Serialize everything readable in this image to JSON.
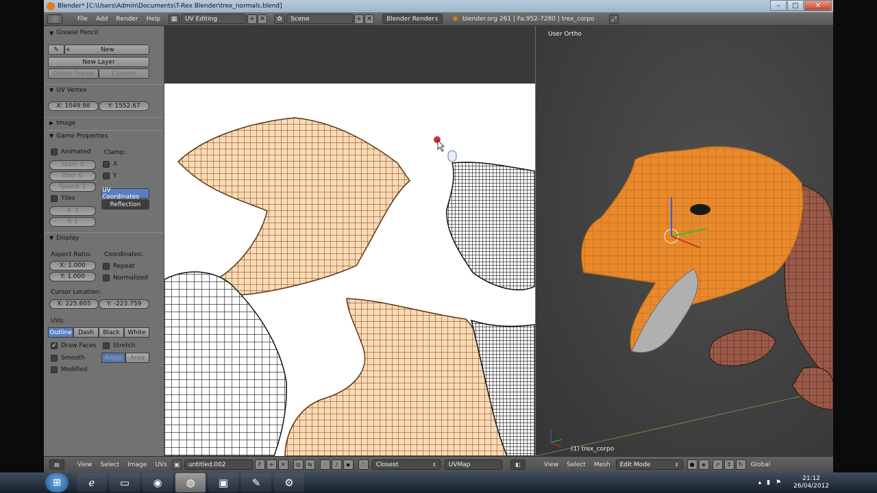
{
  "window": {
    "title": "Blender* [C:\\Users\\Admin\\Documents\\T-Rex Blender\\trex_normals.blend]",
    "min": "–",
    "max": "□",
    "close": "✕"
  },
  "topbar": {
    "menus": [
      "File",
      "Add",
      "Render",
      "Help"
    ],
    "screen_layout": "UV Editing",
    "scene": "Scene",
    "render_engine": "Blender Render",
    "info": "blender.org 261 | Fa:952-7280 | trex_corpo"
  },
  "grease_pencil": {
    "header": "Grease Pencil",
    "new": "New",
    "new_layer": "New Layer",
    "delete_frame": "Delete Frame",
    "convert": "Convert"
  },
  "uv_vertex": {
    "header": "UV Vertex",
    "x": "X: 1049.98",
    "y": "Y: 1552.67"
  },
  "image": {
    "header": "Image"
  },
  "game_properties": {
    "header": "Game Properties",
    "animated": "Animated",
    "clamp": "Clamp:",
    "start": "Start: 0",
    "end": "End: 0",
    "speed": "Speed: 1",
    "clamp_x": "X",
    "clamp_y": "Y",
    "uv_coordinates": "UV Coordinates",
    "reflection": "Reflection",
    "tiles": "Tiles",
    "tiles_x": "X: 1",
    "tiles_y": "Y: 1"
  },
  "display": {
    "header": "Display",
    "aspect_ratio": "Aspect Ratio:",
    "coordinates": "Coordinates:",
    "aspect_x": "X: 1.000",
    "aspect_y": "Y: 1.000",
    "repeat": "Repeat",
    "normalized": "Normalized",
    "cursor_location": "Cursor Location:",
    "cursor_x": "X: 225.605",
    "cursor_y": "Y: -223.759",
    "uvs": "UVs:",
    "uv_modes": [
      "Outline",
      "Dash",
      "Black",
      "White"
    ],
    "draw_faces": "Draw Faces",
    "stretch": "Stretch",
    "smooth": "Smooth",
    "angle": "Angle",
    "area": "Area",
    "modified": "Modified"
  },
  "viewport": {
    "label": "User Ortho",
    "object": "(1) trex_corpo"
  },
  "uv_header": {
    "menus": [
      "View",
      "Select",
      "Image",
      "UVs"
    ],
    "image_name": "untitled.002",
    "fake_user": "F",
    "snap": "Closest",
    "uvmap": "UVMap"
  },
  "view3d_header": {
    "menus": [
      "View",
      "Select",
      "Mesh"
    ],
    "mode": "Edit Mode",
    "orientation": "Global"
  },
  "taskbar": {
    "time": "21:12",
    "date": "26/04/2012"
  },
  "colors": {
    "uv_fill": "#fbd9b4",
    "mesh_orange": "#e8892c",
    "selected_button": "#5680c2"
  }
}
